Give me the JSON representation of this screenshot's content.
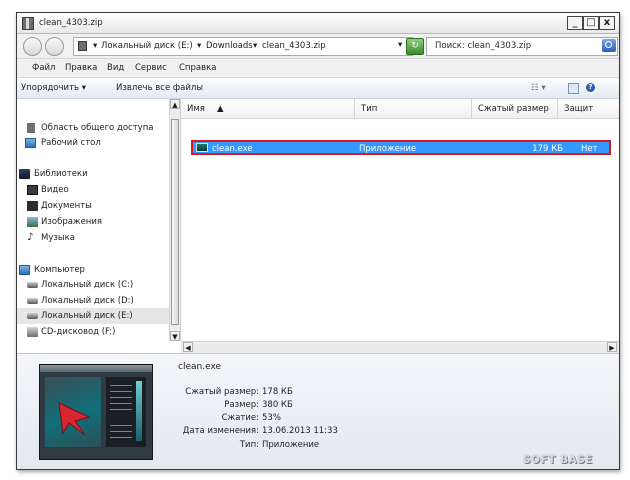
{
  "window": {
    "title": "clean_4303.zip",
    "controls": {
      "minimize": "_",
      "maximize": "□",
      "close": "x"
    }
  },
  "address": {
    "crumbs": [
      "Локальный диск (E:)",
      "Downloads",
      "clean_4303.zip"
    ],
    "search_placeholder": "Поиск: clean_4303.zip"
  },
  "menu": [
    "Файл",
    "Правка",
    "Вид",
    "Сервис",
    "Справка"
  ],
  "commands": {
    "organize": "Упорядочить",
    "extract_all": "Извлечь все файлы"
  },
  "nav": {
    "favorites": [
      {
        "label": "Область общего доступа",
        "icon": "folder-icon"
      },
      {
        "label": "Рабочий стол",
        "icon": "desktop-icon"
      }
    ],
    "libraries": {
      "label": "Библиотеки",
      "items": [
        "Видео",
        "Документы",
        "Изображения",
        "Музыка"
      ]
    },
    "computer": {
      "label": "Компьютер",
      "items": [
        "Локальный диск (C:)",
        "Локальный диск (D:)",
        "Локальный диск (E:)",
        "CD-дисковод (F:)"
      ],
      "selected": "Локальный диск (E:)"
    }
  },
  "columns": [
    "Имя",
    "Тип",
    "Сжатый размер",
    "Защит"
  ],
  "files": [
    {
      "name": "clean.exe",
      "type": "Приложение",
      "compressed": "179 КБ",
      "protected": "Нет",
      "selected": true
    }
  ],
  "details": {
    "filename": "clean.exe",
    "fields": [
      {
        "label": "Сжатый размер:",
        "value": "178 КБ"
      },
      {
        "label": "Размер:",
        "value": "380 КБ"
      },
      {
        "label": "Сжатие:",
        "value": "53%"
      },
      {
        "label": "Дата изменения:",
        "value": "13.06.2013 11:33"
      },
      {
        "label": "Тип:",
        "value": "Приложение"
      }
    ]
  },
  "watermark": "SOFT BASE",
  "colors": {
    "selection": "#3399ff",
    "highlight_border": "#d81c20",
    "accent": "#1f5fb5"
  }
}
